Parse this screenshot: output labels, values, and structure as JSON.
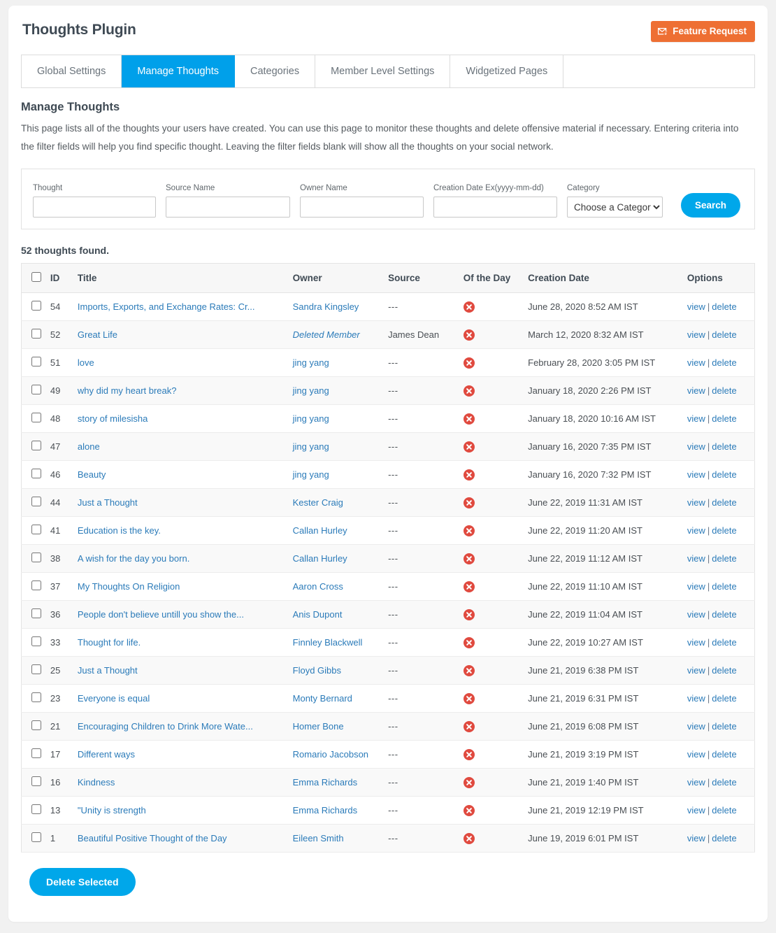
{
  "header": {
    "title": "Thoughts Plugin",
    "feature_request_label": "Feature Request",
    "feature_request_icon": "envelope-edit-icon",
    "feature_request_color": "#ee6f33"
  },
  "tabs": [
    {
      "label": "Global Settings",
      "active": false
    },
    {
      "label": "Manage Thoughts",
      "active": true
    },
    {
      "label": "Categories",
      "active": false
    },
    {
      "label": "Member Level Settings",
      "active": false
    },
    {
      "label": "Widgetized Pages",
      "active": false
    }
  ],
  "active_tab_color": "#00a0ea",
  "intro": {
    "heading": "Manage Thoughts",
    "body": "This page lists all of the thoughts your users have created. You can use this page to monitor these thoughts and delete offensive material if necessary. Entering criteria into the filter fields will help you find specific thought. Leaving the filter fields blank will show all the thoughts on your social network."
  },
  "filters": {
    "thought": {
      "label": "Thought",
      "value": "",
      "placeholder": ""
    },
    "source_name": {
      "label": "Source Name",
      "value": "",
      "placeholder": ""
    },
    "owner_name": {
      "label": "Owner Name",
      "value": "",
      "placeholder": ""
    },
    "creation_date": {
      "label": "Creation Date Ex(yyyy-mm-dd)",
      "value": "",
      "placeholder": ""
    },
    "category": {
      "label": "Category",
      "selected": "Choose a Category",
      "options": [
        "Choose a Category"
      ]
    },
    "search_label": "Search"
  },
  "results": {
    "count_text": "52 thoughts found.",
    "columns": [
      "",
      "ID",
      "Title",
      "Owner",
      "Source",
      "Of the Day",
      "Creation Date",
      "Options"
    ],
    "view_label": "view",
    "delete_label": "delete",
    "separator": "|",
    "empty_source": "---",
    "of_the_day_icon": "red-x-circle-icon",
    "of_the_day_color": "#e04a3f",
    "rows": [
      {
        "id": "54",
        "title": "Imports, Exports, and Exchange Rates: Cr...",
        "owner": "Sandra Kingsley",
        "owner_deleted": false,
        "source": "---",
        "of_the_day": false,
        "creation_date": "June 28, 2020 8:52 AM IST",
        "checked": false
      },
      {
        "id": "52",
        "title": "Great Life",
        "owner": "Deleted Member",
        "owner_deleted": true,
        "source": "James Dean",
        "of_the_day": false,
        "creation_date": "March 12, 2020 8:32 AM IST",
        "checked": false
      },
      {
        "id": "51",
        "title": "love",
        "owner": "jing yang",
        "owner_deleted": false,
        "source": "---",
        "of_the_day": false,
        "creation_date": "February 28, 2020 3:05 PM IST",
        "checked": false
      },
      {
        "id": "49",
        "title": "why did my heart break?",
        "owner": "jing yang",
        "owner_deleted": false,
        "source": "---",
        "of_the_day": false,
        "creation_date": "January 18, 2020 2:26 PM IST",
        "checked": false
      },
      {
        "id": "48",
        "title": "story of milesisha",
        "owner": "jing yang",
        "owner_deleted": false,
        "source": "---",
        "of_the_day": false,
        "creation_date": "January 18, 2020 10:16 AM IST",
        "checked": false
      },
      {
        "id": "47",
        "title": "alone",
        "owner": "jing yang",
        "owner_deleted": false,
        "source": "---",
        "of_the_day": false,
        "creation_date": "January 16, 2020 7:35 PM IST",
        "checked": false
      },
      {
        "id": "46",
        "title": "Beauty",
        "owner": "jing yang",
        "owner_deleted": false,
        "source": "---",
        "of_the_day": false,
        "creation_date": "January 16, 2020 7:32 PM IST",
        "checked": false
      },
      {
        "id": "44",
        "title": "Just a Thought",
        "owner": "Kester Craig",
        "owner_deleted": false,
        "source": "---",
        "of_the_day": false,
        "creation_date": "June 22, 2019 11:31 AM IST",
        "checked": false
      },
      {
        "id": "41",
        "title": "Education is the key.",
        "owner": "Callan Hurley",
        "owner_deleted": false,
        "source": "---",
        "of_the_day": false,
        "creation_date": "June 22, 2019 11:20 AM IST",
        "checked": false
      },
      {
        "id": "38",
        "title": "A wish for the day you born.",
        "owner": "Callan Hurley",
        "owner_deleted": false,
        "source": "---",
        "of_the_day": false,
        "creation_date": "June 22, 2019 11:12 AM IST",
        "checked": false
      },
      {
        "id": "37",
        "title": "My Thoughts On Religion",
        "owner": "Aaron Cross",
        "owner_deleted": false,
        "source": "---",
        "of_the_day": false,
        "creation_date": "June 22, 2019 11:10 AM IST",
        "checked": false
      },
      {
        "id": "36",
        "title": "People don't believe untill you show the...",
        "owner": "Anis Dupont",
        "owner_deleted": false,
        "source": "---",
        "of_the_day": false,
        "creation_date": "June 22, 2019 11:04 AM IST",
        "checked": false
      },
      {
        "id": "33",
        "title": "Thought for life.",
        "owner": "Finnley Blackwell",
        "owner_deleted": false,
        "source": "---",
        "of_the_day": false,
        "creation_date": "June 22, 2019 10:27 AM IST",
        "checked": false
      },
      {
        "id": "25",
        "title": "Just a Thought",
        "owner": "Floyd Gibbs",
        "owner_deleted": false,
        "source": "---",
        "of_the_day": false,
        "creation_date": "June 21, 2019 6:38 PM IST",
        "checked": false
      },
      {
        "id": "23",
        "title": "Everyone is equal",
        "owner": "Monty Bernard",
        "owner_deleted": false,
        "source": "---",
        "of_the_day": false,
        "creation_date": "June 21, 2019 6:31 PM IST",
        "checked": false
      },
      {
        "id": "21",
        "title": "Encouraging Children to Drink More Wate...",
        "owner": "Homer Bone",
        "owner_deleted": false,
        "source": "---",
        "of_the_day": false,
        "creation_date": "June 21, 2019 6:08 PM IST",
        "checked": false
      },
      {
        "id": "17",
        "title": "Different ways",
        "owner": "Romario Jacobson",
        "owner_deleted": false,
        "source": "---",
        "of_the_day": false,
        "creation_date": "June 21, 2019 3:19 PM IST",
        "checked": false
      },
      {
        "id": "16",
        "title": "Kindness",
        "owner": "Emma Richards",
        "owner_deleted": false,
        "source": "---",
        "of_the_day": false,
        "creation_date": "June 21, 2019 1:40 PM IST",
        "checked": false
      },
      {
        "id": "13",
        "title": "\"Unity is strength",
        "owner": "Emma Richards",
        "owner_deleted": false,
        "source": "---",
        "of_the_day": false,
        "creation_date": "June 21, 2019 12:19 PM IST",
        "checked": false
      },
      {
        "id": "1",
        "title": "Beautiful Positive Thought of the Day",
        "owner": "Eileen Smith",
        "owner_deleted": false,
        "source": "---",
        "of_the_day": false,
        "creation_date": "June 19, 2019 6:01 PM IST",
        "checked": false
      }
    ]
  },
  "footer": {
    "delete_selected_label": "Delete Selected",
    "button_color": "#00a7ea"
  }
}
